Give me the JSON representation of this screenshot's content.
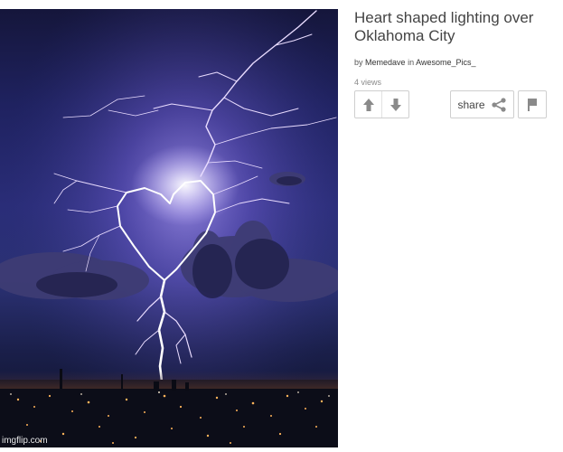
{
  "post": {
    "title": "Heart shaped lighting over Oklahoma City",
    "by_prefix": "by",
    "author": "Memedave",
    "in_prefix": "in",
    "stream": "Awesome_Pics_",
    "views": "4 views"
  },
  "image": {
    "watermark": "imgflip.com",
    "description_icon": "lightning-photo"
  },
  "actions": {
    "upvote_icon": "arrow-up-icon",
    "downvote_icon": "arrow-down-icon",
    "share_label": "share",
    "share_icon": "share-icon",
    "flag_icon": "flag-icon"
  },
  "colors": {
    "sky_top": "#15163b",
    "sky_mid": "#2a2d78",
    "lightning": "#e9dcff",
    "city_lights": "#ffb35a",
    "button_border": "#cfcfcf",
    "icon_gray": "#8a8a8a"
  }
}
